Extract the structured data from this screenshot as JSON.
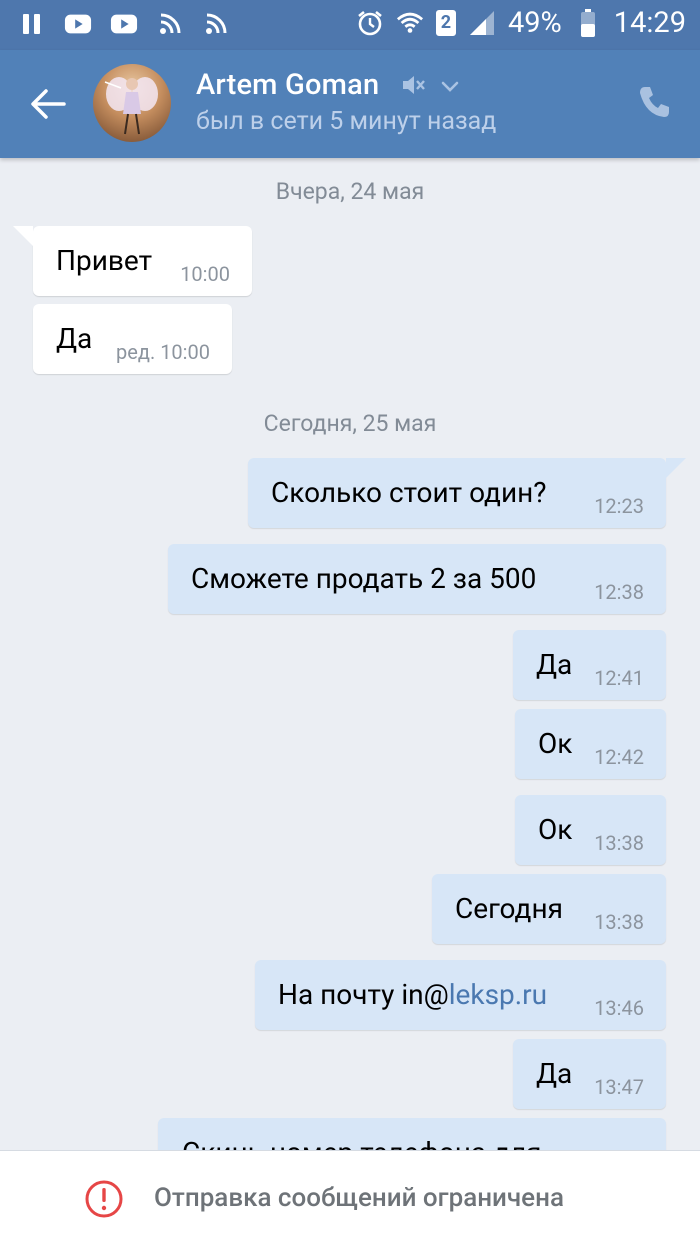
{
  "status_bar": {
    "battery": "49%",
    "time": "14:29",
    "sim_slot": "2",
    "icons": [
      "pause-icon",
      "youtube-icon",
      "youtube-icon",
      "rss-icon",
      "rss-icon",
      "alarm-icon",
      "wifi-icon",
      "sim-icon",
      "signal-icon",
      "battery-icon"
    ]
  },
  "header": {
    "contact_name": "Artem Goman",
    "last_seen": "был в сети 5 минут назад",
    "icons": [
      "back-arrow-icon",
      "muted-icon",
      "chevron-down-icon",
      "phone-icon"
    ]
  },
  "chat": {
    "dates": {
      "yesterday": "Вчера, 24 мая",
      "today": "Сегодня, 25 мая"
    },
    "messages": [
      {
        "direction": "in",
        "text": "Привет",
        "time": "10:00"
      },
      {
        "direction": "in",
        "text": "Да",
        "time": "ред. 10:00"
      },
      {
        "direction": "out",
        "text": "Сколько стоит один?",
        "time": "12:23"
      },
      {
        "direction": "out",
        "text": "Сможете продать 2 за 500",
        "time": "12:38"
      },
      {
        "direction": "out",
        "text": "Да",
        "time": "12:41"
      },
      {
        "direction": "out",
        "text": "Ок",
        "time": "12:42"
      },
      {
        "direction": "out",
        "text": "Ок",
        "time": "13:38"
      },
      {
        "direction": "out",
        "text": "Сегодня",
        "time": "13:38"
      },
      {
        "direction": "out",
        "text_prefix": "На почту in@",
        "text_link": "leksp.ru",
        "time": "13:46"
      },
      {
        "direction": "out",
        "text": "Да",
        "time": "13:47"
      },
      {
        "direction": "out",
        "text": "Скинь номер телефона для",
        "time": ""
      }
    ]
  },
  "footer": {
    "notice": "Отправка сообщений ограничена",
    "icon": "alert-circle-icon",
    "icon_color": "#e64646"
  },
  "colors": {
    "status_bar": "#4e77ad",
    "header": "#5181b8",
    "background": "#ebeef3",
    "outgoing_bubble": "#d7e6f7",
    "incoming_bubble": "#ffffff",
    "link": "#4a78b0"
  }
}
